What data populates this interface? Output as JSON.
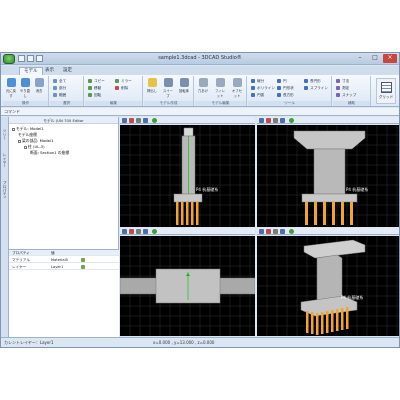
{
  "window": {
    "title": "sample1.3dcad - 3DCAD Studio®"
  },
  "ribbon_tabs": [
    "モデル",
    "表示",
    "設定"
  ],
  "ribbon": {
    "groups": [
      {
        "label": "操作",
        "buttons": [
          "元に戻す",
          "やり直し",
          "消去"
        ]
      },
      {
        "label": "選択",
        "buttons": [
          "全て",
          "部分",
          "範囲"
        ]
      },
      {
        "label": "編集",
        "buttons": [
          "コピー",
          "移動",
          "回転",
          "ミラー",
          "削除"
        ]
      },
      {
        "label": "モデル作成",
        "buttons": [
          "押出し",
          "スイープ",
          "回転体"
        ]
      },
      {
        "label": "モデル編集",
        "buttons": [
          "穴あけ",
          "フィレット",
          "オフセット"
        ]
      },
      {
        "label": "ツール",
        "buttons": [
          "線分",
          "ポリライン",
          "円弧",
          "円",
          "円形状",
          "長方形",
          "長円形",
          "スプライン"
        ]
      },
      {
        "label": "補助",
        "buttons": [
          "寸法",
          "測定",
          "スナップ"
        ]
      }
    ],
    "grid_button": "グリッド"
  },
  "command": {
    "label": "コマンド"
  },
  "side_tabs": [
    "ツリー",
    "レイヤー",
    "プロパティ"
  ],
  "tree": {
    "header": "モデル (UN 700 Editor",
    "rows": [
      "モデル: Model1",
      "モデル座標",
      "梁の部品: Model1",
      "柱 (UL-3)",
      "断面: Section1 の座標"
    ]
  },
  "properties": {
    "rows": [
      {
        "key": "プロパティ",
        "value": "値"
      },
      {
        "key": "マテリアル",
        "value": "Material5"
      },
      {
        "key": "レイヤー",
        "value": "Layer1"
      }
    ]
  },
  "viewports": {
    "front_label": "P4 杭基礎系",
    "side_label": "P4 杭基礎系",
    "iso_label": "P4 杭基礎系"
  },
  "status": {
    "layer": "カレントレイヤー：Layer1",
    "coords": "x=0.000 , y=13.000 , z=0.000"
  },
  "colors": {
    "pile": "#f4a62a",
    "concrete": "#b9b9b9",
    "grid": "#2e2e2e",
    "accent": "#00c000"
  }
}
